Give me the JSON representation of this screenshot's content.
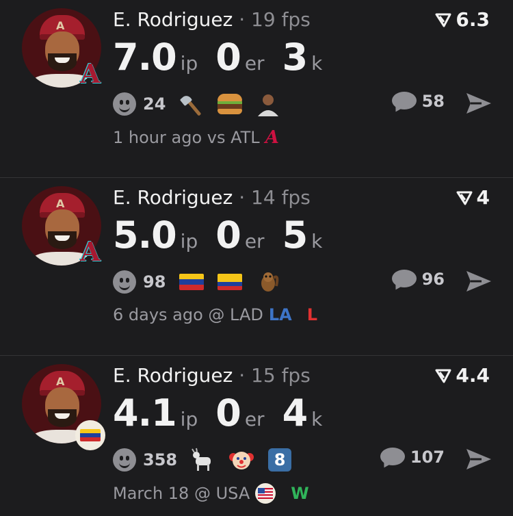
{
  "colors": {
    "background": "#1c1c1e",
    "muted": "#8e8e93",
    "braves": "#ce1141",
    "dodgers": "#3d74c7",
    "loss": "#e03131",
    "win": "#30b35a"
  },
  "posts": [
    {
      "name": "E. Rodriguez",
      "fps_label": "· 19 fps",
      "score": "6.3",
      "ip": "7.0",
      "ip_unit": "ip",
      "er": "0",
      "er_unit": "er",
      "k": "3",
      "k_unit": "k",
      "reaction_count": "24",
      "comment_count": "58",
      "time": "1 hour ago vs ATL",
      "team_logo": "A",
      "result": "",
      "reactions": [
        "axe-icon",
        "hamburger-icon",
        "person-icon"
      ],
      "badge": "dbacks-logo"
    },
    {
      "name": "E. Rodriguez",
      "fps_label": "· 14 fps",
      "score": "4",
      "ip": "5.0",
      "ip_unit": "ip",
      "er": "0",
      "er_unit": "er",
      "k": "5",
      "k_unit": "k",
      "reaction_count": "98",
      "comment_count": "96",
      "time": "6 days ago @ LAD",
      "team_logo": "LA",
      "result": "L",
      "reactions": [
        "venezuela-flag-icon",
        "colombia-flag-icon",
        "squirrel-icon"
      ],
      "badge": "dbacks-logo"
    },
    {
      "name": "E. Rodriguez",
      "fps_label": "· 15 fps",
      "score": "4.4",
      "ip": "4.1",
      "ip_unit": "ip",
      "er": "0",
      "er_unit": "er",
      "k": "4",
      "k_unit": "k",
      "reaction_count": "358",
      "comment_count": "107",
      "time": "March 18 @ USA",
      "team_logo": "",
      "result": "W",
      "reactions": [
        "goat-icon",
        "clown-icon",
        "keycap-8-icon"
      ],
      "keycap": "8",
      "badge": "venezuela-flag"
    }
  ]
}
